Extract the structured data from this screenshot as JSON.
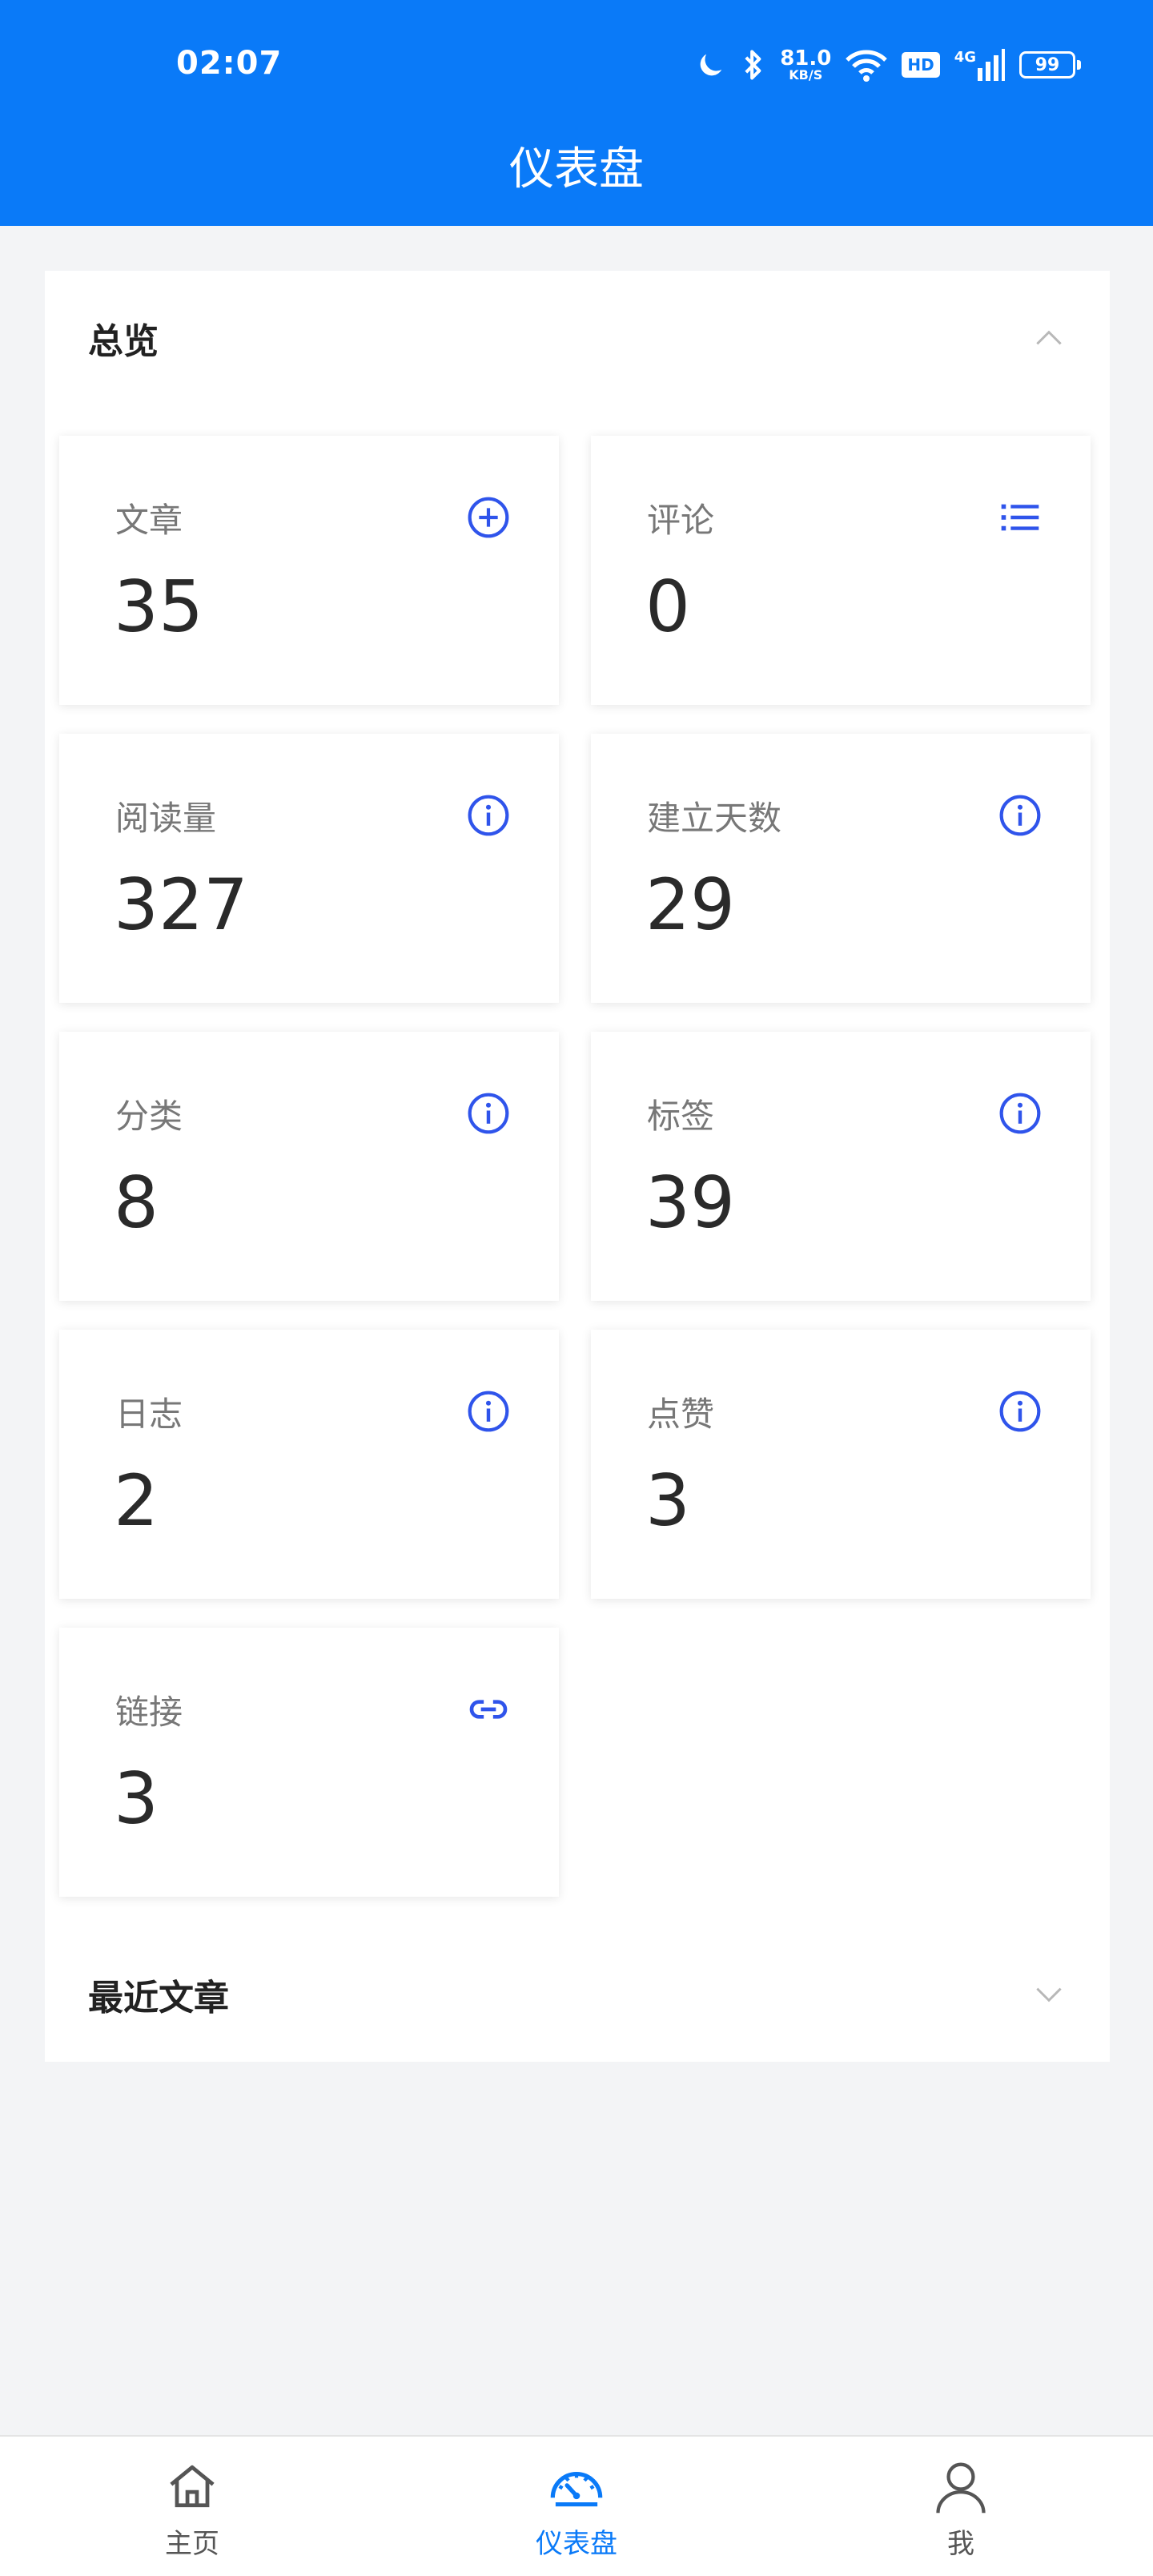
{
  "status_bar": {
    "time": "02:07",
    "net_speed_value": "81.0",
    "net_speed_unit": "KB/S",
    "hd_label": "HD",
    "signal_label": "4G",
    "battery": "99",
    "icons": [
      "moon-icon",
      "bluetooth-icon",
      "wifi-icon",
      "signal-icon",
      "battery-icon"
    ]
  },
  "header": {
    "title": "仪表盘"
  },
  "overview": {
    "title": "总览",
    "stats": [
      {
        "label": "文章",
        "value": "35",
        "icon": "add-circle-icon"
      },
      {
        "label": "评论",
        "value": "0",
        "icon": "list-icon"
      },
      {
        "label": "阅读量",
        "value": "327",
        "icon": "info-icon"
      },
      {
        "label": "建立天数",
        "value": "29",
        "icon": "info-icon"
      },
      {
        "label": "分类",
        "value": "8",
        "icon": "info-icon"
      },
      {
        "label": "标签",
        "value": "39",
        "icon": "info-icon"
      },
      {
        "label": "日志",
        "value": "2",
        "icon": "info-icon"
      },
      {
        "label": "点赞",
        "value": "3",
        "icon": "info-icon"
      },
      {
        "label": "链接",
        "value": "3",
        "icon": "link-icon"
      }
    ]
  },
  "recent_posts": {
    "title": "最近文章"
  },
  "bottom_nav": {
    "items": [
      {
        "label": "主页",
        "icon": "home-icon",
        "active": false
      },
      {
        "label": "仪表盘",
        "icon": "dashboard-icon",
        "active": true
      },
      {
        "label": "我",
        "icon": "user-icon",
        "active": false
      }
    ]
  },
  "colors": {
    "primary": "#0a7af8",
    "icon_accent": "#2f54eb",
    "background": "#f3f4f6"
  }
}
